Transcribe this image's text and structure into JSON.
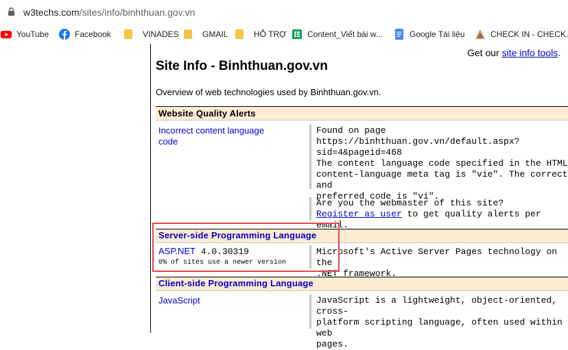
{
  "browser": {
    "url_domain": "w3techs.com",
    "url_path": "/sites/info/binhthuan.gov.vn",
    "bookmarks": [
      {
        "label": "YouTube",
        "icon": "youtube-icon"
      },
      {
        "label": "Facebook",
        "icon": "facebook-icon"
      },
      {
        "label": "VINADES",
        "icon": "folder-icon"
      },
      {
        "label": "GMAIL",
        "icon": "folder-icon"
      },
      {
        "label": "HỖ TRỢ",
        "icon": "folder-icon"
      },
      {
        "label": "Content_Viết bài w...",
        "icon": "sheets-icon"
      },
      {
        "label": "Google Tài liệu",
        "icon": "docs-icon"
      },
      {
        "label": "CHECK IN - CHECK...",
        "icon": "app-icon"
      }
    ]
  },
  "page": {
    "top_right_prefix": "Get our ",
    "top_right_link": "site info tools",
    "top_right_suffix": ".",
    "title": "Site Info - Binhthuan.gov.vn",
    "overview": "Overview of web technologies used by Binhthuan.gov.vn.",
    "alerts": {
      "heading": "Website Quality Alerts",
      "item_link_line1": "Incorrect content language",
      "item_link_line2": "code",
      "desc_lines": [
        "Found on page https://binhthuan.gov.vn/default.aspx?",
        "sid=4&pageid=468",
        "The content language code specified in the HTML",
        "content-language meta tag is \"vie\". The correct and",
        "preferred code is \"vi\"."
      ],
      "webmaster_q": "Are you the webmaster of this site?",
      "register_link": "Register as user",
      "register_suffix": " to get quality alerts per email."
    },
    "server_side": {
      "heading": "Server-side Programming Language",
      "tech_link": "ASP.NET",
      "tech_version": " 4.0.30319",
      "note": "0% of sites use a newer version",
      "desc_lines": [
        "Microsoft's Active Server Pages technology on the",
        ".NET framework."
      ]
    },
    "client_side": {
      "heading": "Client-side Programming Language",
      "tech_link": "JavaScript",
      "desc_lines": [
        "JavaScript is a lightweight, object-oriented, cross-",
        "platform scripting language, often used within web",
        "pages."
      ]
    }
  },
  "colors": {
    "link": "#0000cc",
    "section_bg": "#fdebd3",
    "highlight_box": "#e8474c"
  }
}
